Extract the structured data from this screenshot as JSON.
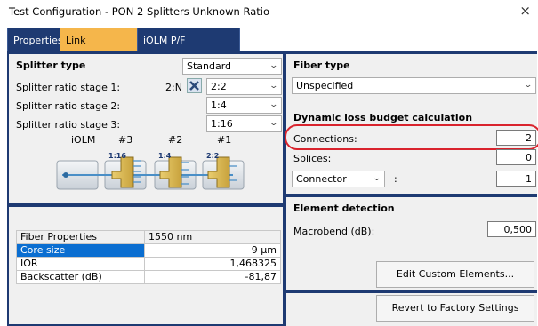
{
  "window": {
    "title": "Test Configuration - PON 2 Splitters Unknown Ratio",
    "close": "×"
  },
  "tabs": [
    {
      "label": "Properties"
    },
    {
      "label": "Link Definition"
    },
    {
      "label": "iOLM P/F Thresholds"
    }
  ],
  "splitter": {
    "heading": "Splitter type",
    "type_value": "Standard",
    "stage1_label": "Splitter ratio stage 1:",
    "stage1_prefix": "2:N",
    "stage1_value": "2:2",
    "stage2_label": "Splitter ratio stage 2:",
    "stage2_value": "1:4",
    "stage3_label": "Splitter ratio stage 3:",
    "stage3_value": "1:16",
    "diagram_labels": [
      "iOLM",
      "#3",
      "#2",
      "#1"
    ],
    "diagram_ratios": [
      "1:16",
      "1:4",
      "2:2"
    ]
  },
  "fiber_props": {
    "header": [
      "Fiber Properties",
      "1550 nm"
    ],
    "rows": [
      {
        "name": "Core size",
        "value": "9 µm"
      },
      {
        "name": "IOR",
        "value": "1,468325"
      },
      {
        "name": "Backscatter (dB)",
        "value": "-81,87"
      }
    ]
  },
  "fiber_type": {
    "heading": "Fiber type",
    "value": "Unspecified"
  },
  "loss_budget": {
    "heading": "Dynamic loss budget calculation",
    "connections_label": "Connections:",
    "connections_value": "2",
    "splices_label": "Splices:",
    "splices_value": "0",
    "element_value": "Connector",
    "element_colon": ":",
    "element_count": "1"
  },
  "element_detection": {
    "heading": "Element detection",
    "macrobend_label": "Macrobend (dB):",
    "macrobend_value": "0,500"
  },
  "buttons": {
    "edit_custom": "Edit Custom Elements...",
    "revert": "Revert to Factory Settings"
  },
  "colors": {
    "highlight_ring": "#d9232d",
    "tab_active": "#f5b64b",
    "tab_inactive": "#1e3a72",
    "selection": "#0a6ed1"
  }
}
